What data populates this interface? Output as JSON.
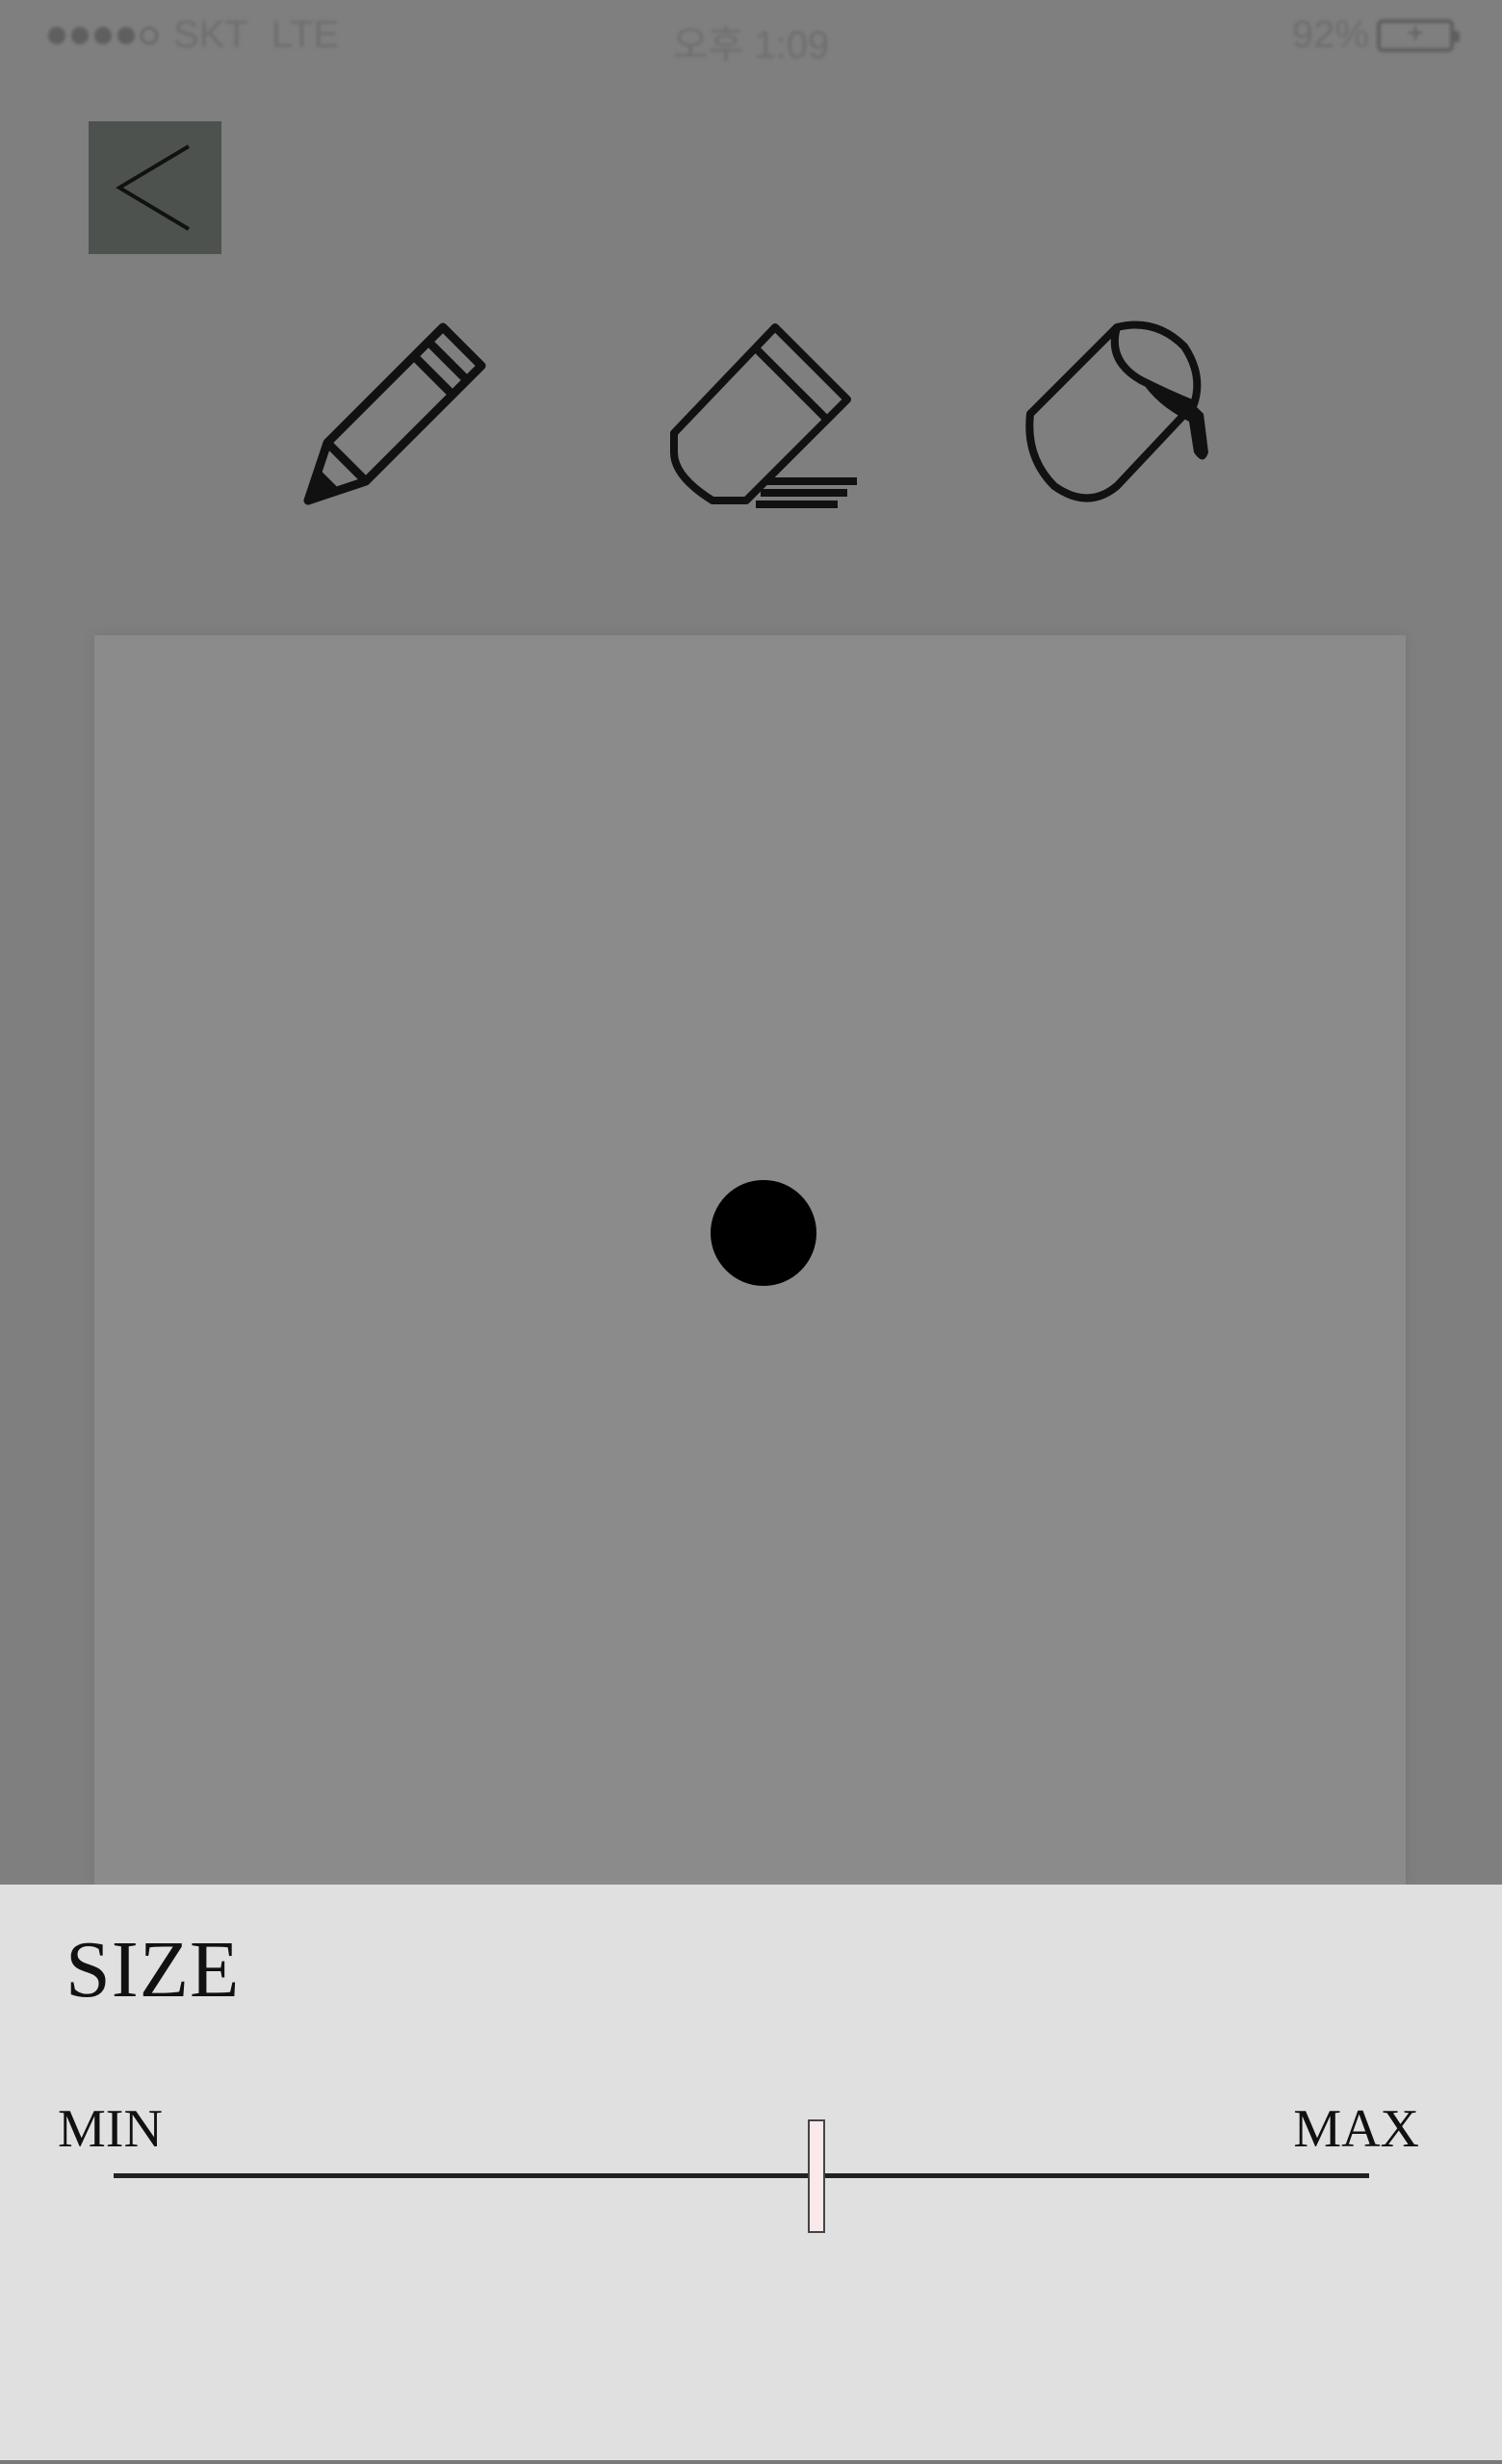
{
  "status_bar": {
    "carrier": "SKT",
    "network": "LTE",
    "time": "오후 1:09",
    "battery": "92%",
    "signal_icon": "signal-dots-icon",
    "battery_icon": "battery-charging-icon"
  },
  "nav": {
    "back_icon": "chevron-left-icon"
  },
  "toolbar": {
    "tools": [
      {
        "name": "pencil",
        "icon": "pencil-icon"
      },
      {
        "name": "eraser",
        "icon": "eraser-icon"
      },
      {
        "name": "fill",
        "icon": "paint-bucket-icon"
      }
    ]
  },
  "canvas": {
    "brush_preview_color": "#000000"
  },
  "size_panel": {
    "title": "SIZE",
    "min_label": "MIN",
    "max_label": "MAX",
    "slider_value": 0.56
  },
  "colors": {
    "overlay": "#7f7f7f",
    "canvas": "#8b8b8b",
    "panel": "#e0e0e0",
    "slider_thumb": "#fbe9ea"
  }
}
